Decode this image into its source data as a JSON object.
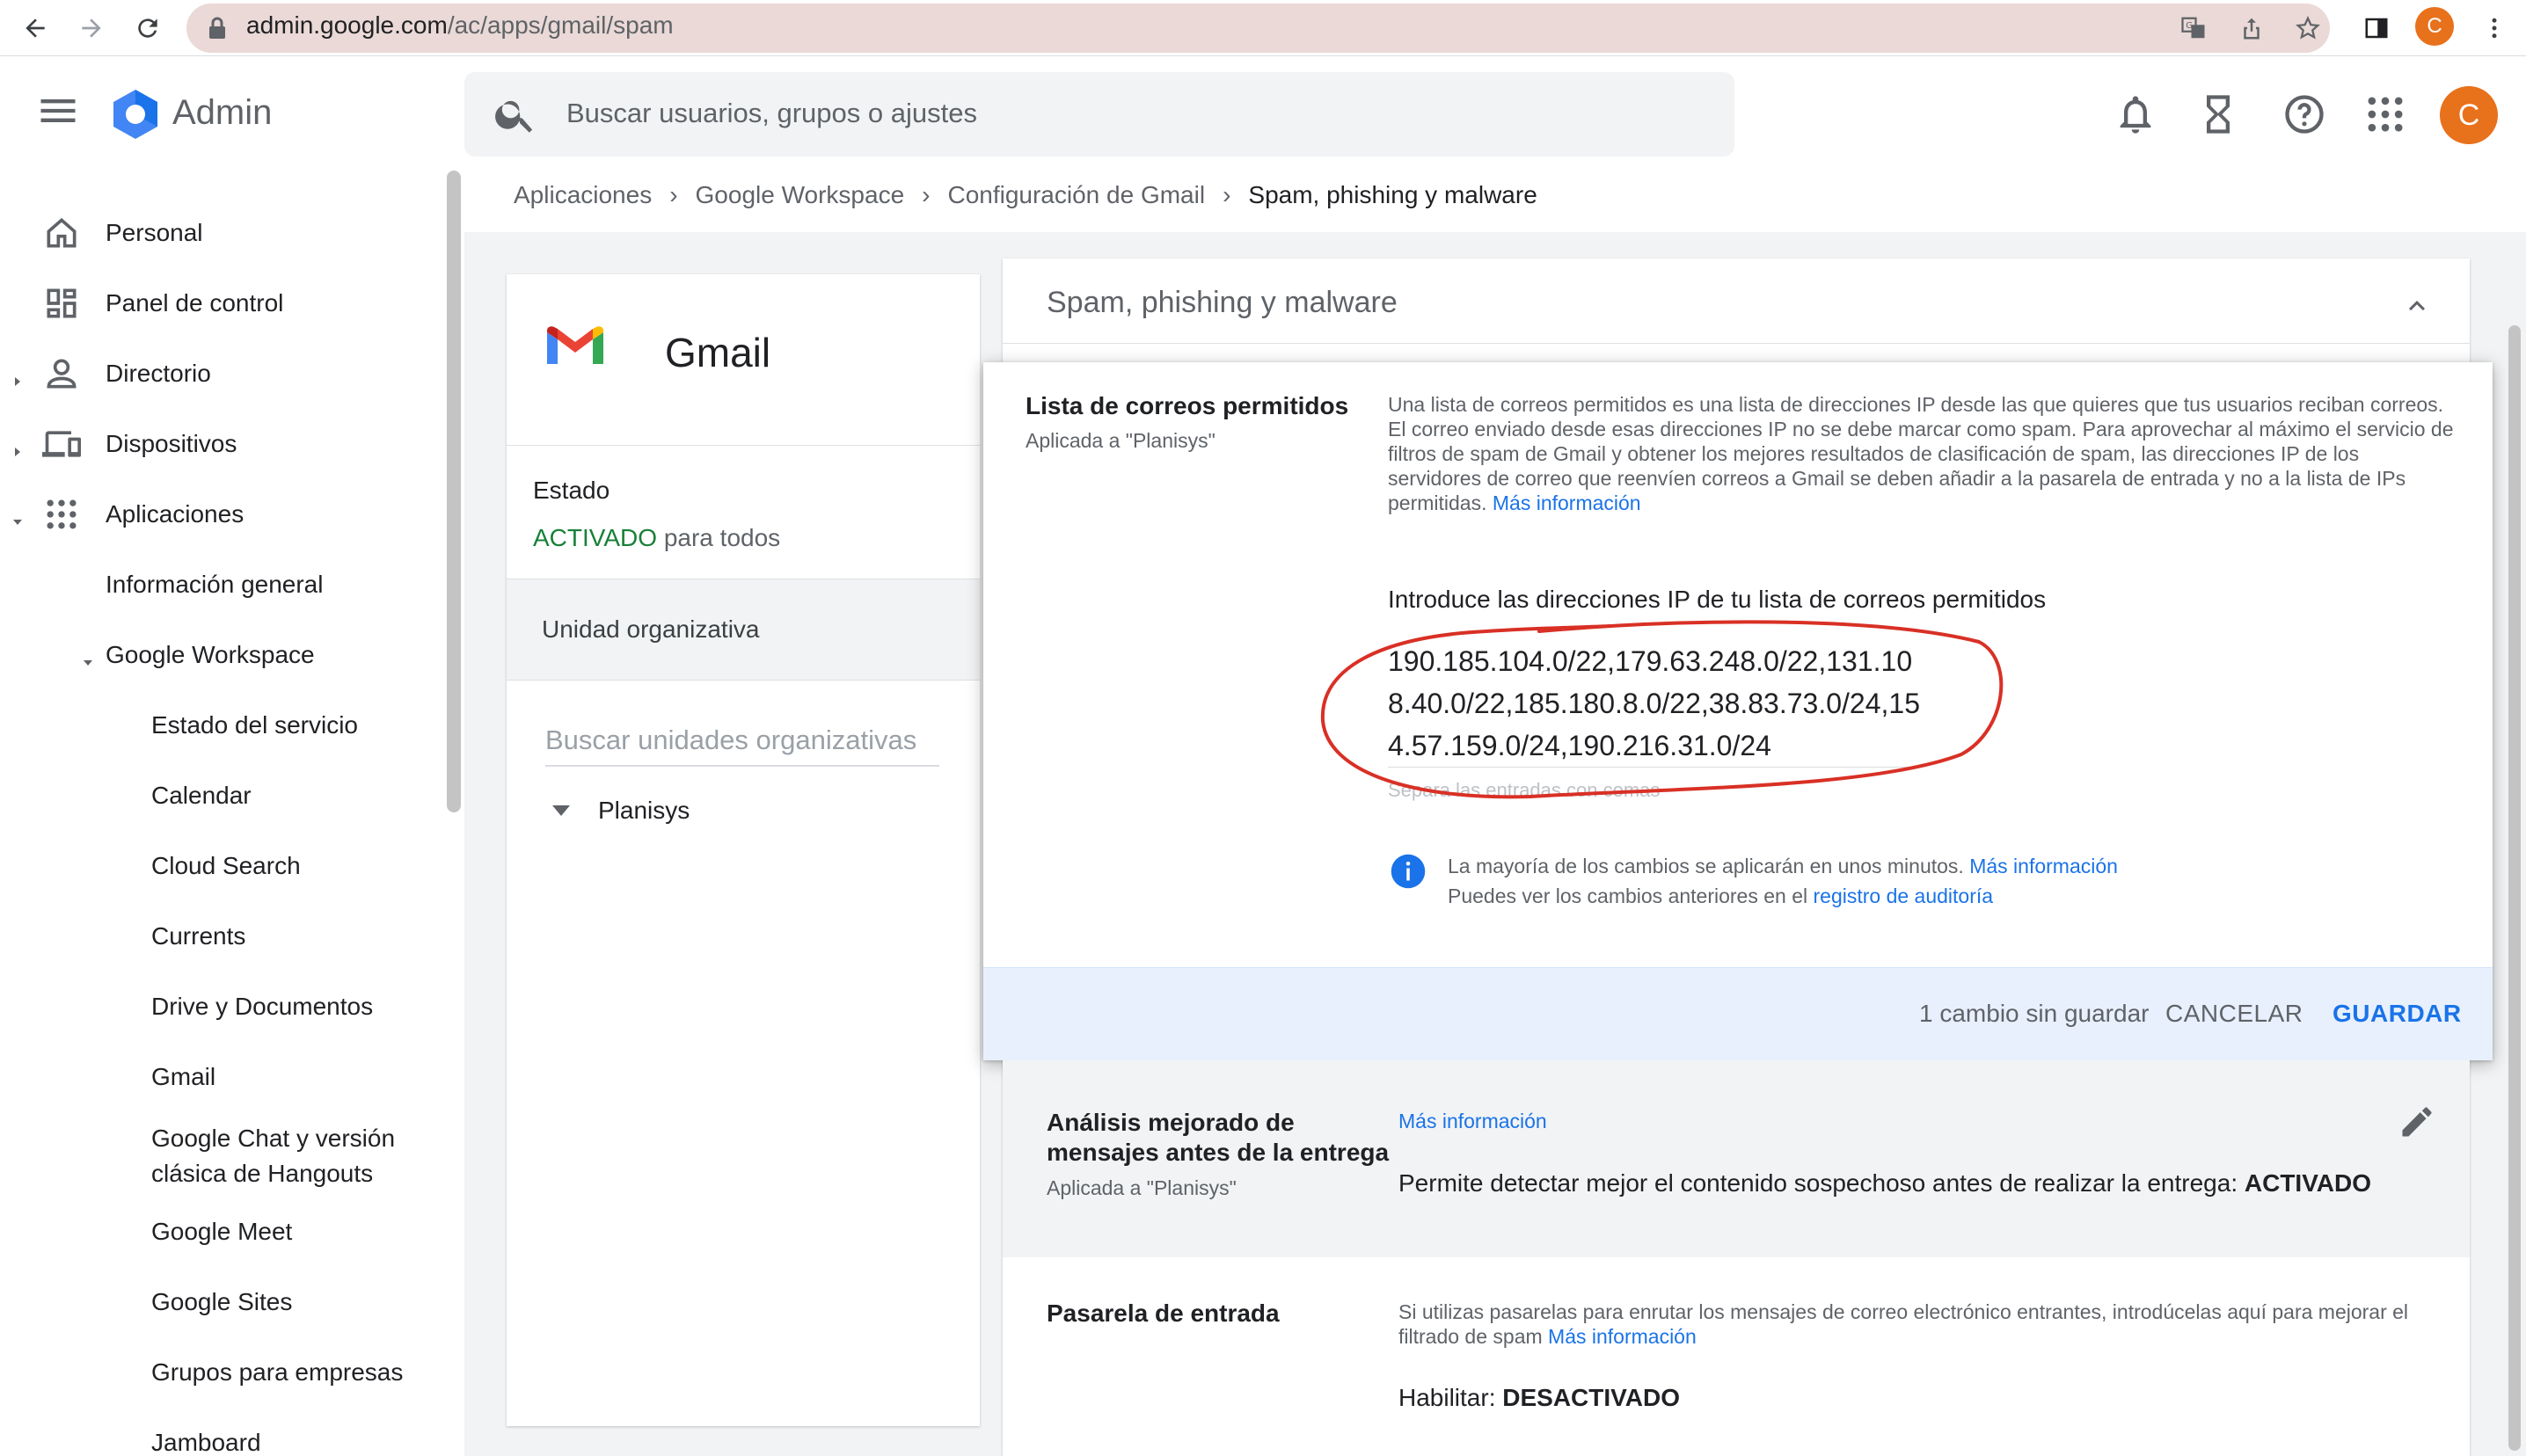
{
  "browser": {
    "url_host": "admin.google.com",
    "url_path": "/ac/apps/gmail/spam",
    "avatar_letter": "C"
  },
  "header": {
    "title": "Admin",
    "search_placeholder": "Buscar usuarios, grupos o ajustes",
    "avatar_letter": "C"
  },
  "sidebar": {
    "items": [
      {
        "label": "Personal",
        "icon": "home-icon"
      },
      {
        "label": "Panel de control",
        "icon": "dashboard-icon"
      },
      {
        "label": "Directorio",
        "icon": "person-icon"
      },
      {
        "label": "Dispositivos",
        "icon": "devices-icon"
      },
      {
        "label": "Aplicaciones",
        "icon": "apps-icon"
      },
      {
        "label": "Información general"
      },
      {
        "label": "Google Workspace"
      },
      {
        "label": "Estado del servicio"
      },
      {
        "label": "Calendar"
      },
      {
        "label": "Cloud Search"
      },
      {
        "label": "Currents"
      },
      {
        "label": "Drive y Documentos"
      },
      {
        "label": "Gmail"
      },
      {
        "label": "Google Chat y versión clásica de Hangouts"
      },
      {
        "label": "Google Meet"
      },
      {
        "label": "Google Sites"
      },
      {
        "label": "Grupos para empresas"
      },
      {
        "label": "Jamboard"
      }
    ]
  },
  "breadcrumb": [
    "Aplicaciones",
    "Google Workspace",
    "Configuración de Gmail",
    "Spam, phishing y malware"
  ],
  "left_card": {
    "app_name": "Gmail",
    "estado_label": "Estado",
    "estado_on": "ACTIVADO",
    "estado_rest": " para todos",
    "ou_label": "Unidad organizativa",
    "ou_search_placeholder": "Buscar unidades organizativas",
    "ou_root": "Planisys"
  },
  "section": {
    "title": "Spam, phishing y malware"
  },
  "allowlist": {
    "title": "Lista de correos permitidos",
    "applied": "Aplicada a \"Planisys\"",
    "description": "Una lista de correos permitidos es una lista de direcciones IP desde las que quieres que tus usuarios reciban correos. El correo enviado desde esas direcciones IP no se debe marcar como spam. Para aprovechar al máximo el servicio de filtros de spam de Gmail y obtener los mejores resultados de clasificación de spam, las direcciones IP de los servidores de correo que reenvíen correos a Gmail se deben añadir a la pasarela de entrada y no a la lista de IPs permitidas.",
    "more_info": "Más información",
    "input_label": "Introduce las direcciones IP de tu lista de correos permitidos",
    "input_value": "190.185.104.0/22,179.63.248.0/22,131.108.40.0/22,185.180.8.0/22,38.83.73.0/24,154.57.159.0/24,190.216.31.0/24",
    "input_hint": "Separa las entradas con comas",
    "info_line1": "La mayoría de los cambios se aplicarán en unos minutos. ",
    "info_link1": "Más información",
    "info_line2": "Puedes ver los cambios anteriores en el ",
    "info_link2": "registro de auditoría"
  },
  "footer": {
    "unsaved": "1 cambio sin guardar",
    "cancel": "CANCELAR",
    "save": "GUARDAR"
  },
  "precheck": {
    "title": "Análisis mejorado de mensajes antes de la entrega",
    "applied": "Aplicada a \"Planisys\"",
    "link": "Más información",
    "value_text": "Permite detectar mejor el contenido sospechoso antes de realizar la entrega: ",
    "value_state": "ACTIVADO"
  },
  "gateway": {
    "title": "Pasarela de entrada",
    "description": "Si utilizas pasarelas para enrutar los mensajes de correo electrónico entrantes, introdúcelas aquí para mejorar el filtrado de spam ",
    "link": "Más información",
    "value_text": "Habilitar: ",
    "value_state": "DESACTIVADO"
  },
  "colors": {
    "accent": "#1a73e8",
    "active_green": "#188038",
    "annotation_red": "#d93025",
    "avatar_orange": "#e8711c"
  }
}
